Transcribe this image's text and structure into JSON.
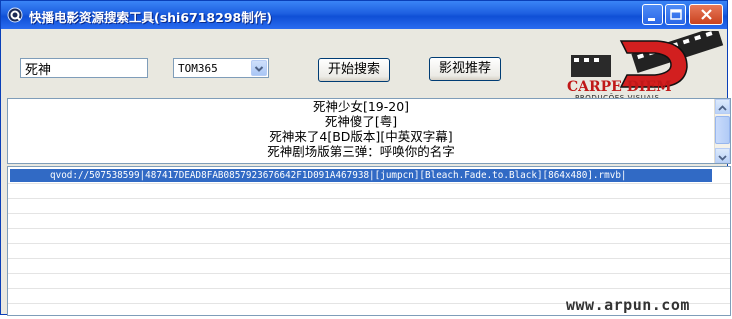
{
  "window": {
    "title": "快播电影资源搜索工具(shi6718298制作)",
    "icon": "qvod-app-icon",
    "accent": "#1d5fe0"
  },
  "search": {
    "value": "死神",
    "source_selected": "TOM365",
    "search_label": "开始搜索",
    "recommend_label": "影视推荐"
  },
  "logo": {
    "line1": "CARPE DIEM",
    "line2": "PRODUÇÕES VISUAIS"
  },
  "results": [
    "死神少女[19-20]",
    "死神傻了[粤]",
    "死神来了4[BD版本][中英双字幕]",
    "死神剧场版第三弹：呼唤你的名字"
  ],
  "links": [
    "qvod://507538599|487417DEAD8FAB0857923676642F1D091A467938|[jumpcn][Bleach.Fade.to.Black][864x480].rmvb|"
  ],
  "watermark": "www.arpun.com",
  "colors": {
    "selection": "#316ac5",
    "logo_red": "#d21f1f"
  }
}
